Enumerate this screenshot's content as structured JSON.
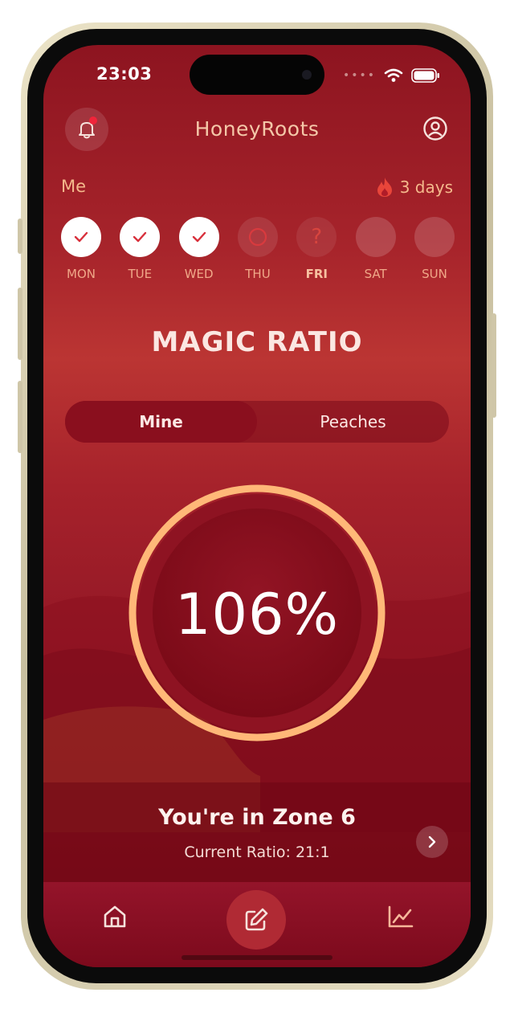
{
  "status_bar": {
    "time": "23:03",
    "signal_dots": "••••"
  },
  "app_bar": {
    "title": "HoneyRoots"
  },
  "streak": {
    "user_label": "Me",
    "count_label": "3 days"
  },
  "week": [
    {
      "label": "MON",
      "state": "done"
    },
    {
      "label": "TUE",
      "state": "done"
    },
    {
      "label": "WED",
      "state": "done"
    },
    {
      "label": "THU",
      "state": "pending"
    },
    {
      "label": "FRI",
      "state": "today"
    },
    {
      "label": "SAT",
      "state": "future"
    },
    {
      "label": "SUN",
      "state": "future"
    }
  ],
  "today_glyph": "?",
  "section": {
    "title": "MAGIC RATIO"
  },
  "toggle": {
    "options": [
      "Mine",
      "Peaches"
    ],
    "selected": "Mine"
  },
  "gauge": {
    "value_label": "106%",
    "progress_percent": 106
  },
  "zone": {
    "title": "You're in Zone 6",
    "current_ratio": "Current Ratio: 21:1"
  },
  "colors": {
    "accent": "#ffb878",
    "background_top": "#8d1420",
    "background_mid": "#bb3533",
    "panel": "#7a0b17",
    "check": "#d8303c",
    "flame": "#e8453a"
  },
  "icons": {
    "notifications": "bell-icon",
    "profile": "user-circle-icon",
    "streak": "flame-icon",
    "zone_details": "chevron-right-icon",
    "tab_home": "home-icon",
    "tab_compose": "edit-icon",
    "tab_stats": "chart-line-icon"
  }
}
